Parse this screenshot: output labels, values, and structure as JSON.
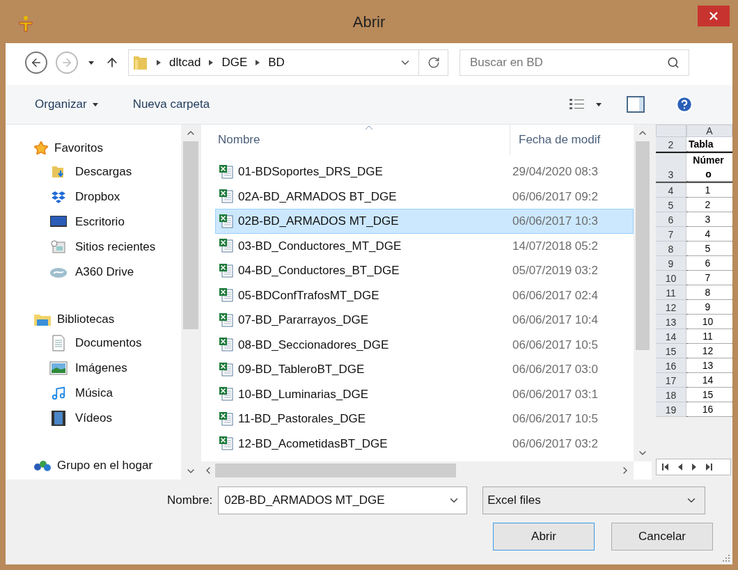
{
  "window": {
    "title": "Abrir"
  },
  "address": {
    "path": [
      "dltcad",
      "DGE",
      "BD"
    ],
    "search_placeholder": "Buscar en BD"
  },
  "toolbar": {
    "organize": "Organizar",
    "new_folder": "Nueva carpeta"
  },
  "sidebar": {
    "groups": [
      {
        "label": "Favoritos",
        "kind": "star",
        "children": [
          {
            "label": "Descargas",
            "kind": "downloads"
          },
          {
            "label": "Dropbox",
            "kind": "dropbox"
          },
          {
            "label": "Escritorio",
            "kind": "desktop"
          },
          {
            "label": "Sitios recientes",
            "kind": "recent"
          },
          {
            "label": "A360 Drive",
            "kind": "cloud"
          }
        ]
      },
      {
        "label": "Bibliotecas",
        "kind": "library",
        "children": [
          {
            "label": "Documentos",
            "kind": "documents"
          },
          {
            "label": "Imágenes",
            "kind": "pictures"
          },
          {
            "label": "Música",
            "kind": "music"
          },
          {
            "label": "Vídeos",
            "kind": "videos"
          }
        ]
      },
      {
        "label": "Grupo en el hogar",
        "kind": "homegroup"
      }
    ]
  },
  "files": {
    "columns": [
      "Nombre",
      "Fecha de modif"
    ],
    "rows": [
      {
        "name": "01-BDSoportes_DRS_DGE",
        "date": "29/04/2020 08:3",
        "selected": false
      },
      {
        "name": "02A-BD_ARMADOS BT_DGE",
        "date": "06/06/2017 09:2",
        "selected": false
      },
      {
        "name": "02B-BD_ARMADOS MT_DGE",
        "date": "06/06/2017 10:3",
        "selected": true
      },
      {
        "name": "03-BD_Conductores_MT_DGE",
        "date": "14/07/2018 05:2",
        "selected": false
      },
      {
        "name": "04-BD_Conductores_BT_DGE",
        "date": "05/07/2019 03:2",
        "selected": false
      },
      {
        "name": "05-BDConfTrafosMT_DGE",
        "date": "06/06/2017 02:4",
        "selected": false
      },
      {
        "name": "07-BD_Pararrayos_DGE",
        "date": "06/06/2017 10:4",
        "selected": false
      },
      {
        "name": "08-BD_Seccionadores_DGE",
        "date": "06/06/2017 10:5",
        "selected": false
      },
      {
        "name": "09-BD_TableroBT_DGE",
        "date": "06/06/2017 03:0",
        "selected": false
      },
      {
        "name": "10-BD_Luminarias_DGE",
        "date": "06/06/2017 03:1",
        "selected": false
      },
      {
        "name": "11-BD_Pastorales_DGE",
        "date": "06/06/2017 10:5",
        "selected": false
      },
      {
        "name": "12-BD_AcometidasBT_DGE",
        "date": "06/06/2017 03:2",
        "selected": false
      }
    ]
  },
  "preview": {
    "column": "A",
    "rows": [
      {
        "number": "2",
        "lines": [
          "Tabla"
        ],
        "kind": "title"
      },
      {
        "number": "3",
        "lines": [
          "Númer",
          "o"
        ],
        "kind": "header"
      },
      {
        "number": "4",
        "lines": [
          "1"
        ],
        "kind": "data"
      },
      {
        "number": "5",
        "lines": [
          "2"
        ],
        "kind": "data"
      },
      {
        "number": "6",
        "lines": [
          "3"
        ],
        "kind": "data"
      },
      {
        "number": "7",
        "lines": [
          "4"
        ],
        "kind": "data"
      },
      {
        "number": "8",
        "lines": [
          "5"
        ],
        "kind": "data"
      },
      {
        "number": "9",
        "lines": [
          "6"
        ],
        "kind": "data"
      },
      {
        "number": "10",
        "lines": [
          "7"
        ],
        "kind": "data"
      },
      {
        "number": "11",
        "lines": [
          "8"
        ],
        "kind": "data"
      },
      {
        "number": "12",
        "lines": [
          "9"
        ],
        "kind": "data"
      },
      {
        "number": "13",
        "lines": [
          "10"
        ],
        "kind": "data"
      },
      {
        "number": "14",
        "lines": [
          "11"
        ],
        "kind": "data"
      },
      {
        "number": "15",
        "lines": [
          "12"
        ],
        "kind": "data"
      },
      {
        "number": "16",
        "lines": [
          "13"
        ],
        "kind": "data"
      },
      {
        "number": "17",
        "lines": [
          "14"
        ],
        "kind": "data"
      },
      {
        "number": "18",
        "lines": [
          "15"
        ],
        "kind": "data"
      },
      {
        "number": "19",
        "lines": [
          "16"
        ],
        "kind": "data"
      }
    ]
  },
  "footer": {
    "name_label": "Nombre:",
    "name_value": "02B-BD_ARMADOS MT_DGE",
    "filter": "Excel files",
    "buttons": [
      "Abrir",
      "Cancelar"
    ]
  }
}
